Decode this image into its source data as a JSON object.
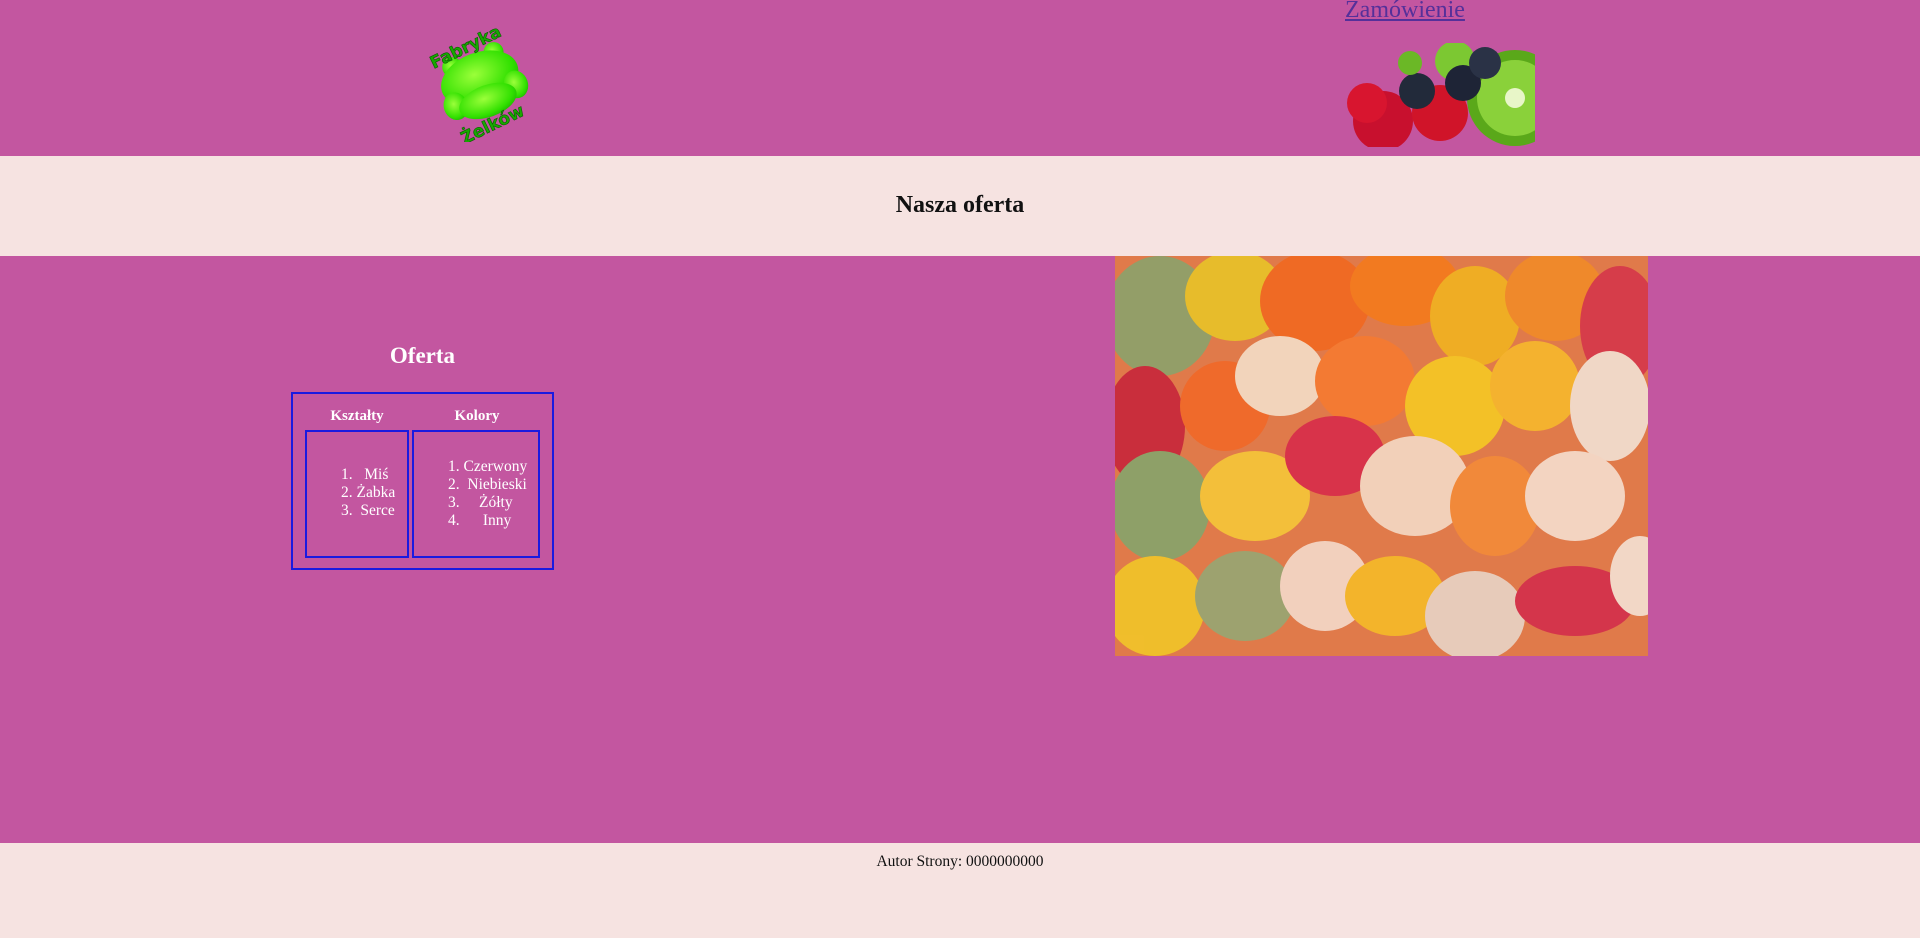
{
  "header": {
    "logo": {
      "text_top": "Fabryka",
      "text_bottom": "Żelków",
      "icon": "gummy-bear-logo-icon"
    },
    "order_link": "Zamówienie",
    "fruit_image_icon": "fruit-jellies-image"
  },
  "title": "Nasza oferta",
  "offer": {
    "heading": "Oferta",
    "columns": [
      "Kształty",
      "Kolory"
    ],
    "shapes": [
      "Miś",
      "Żabka",
      "Serce"
    ],
    "colors": [
      "Czerwony",
      "Niebieski",
      "Żółty",
      "Inny"
    ]
  },
  "candy_image_icon": "gummy-bears-photo",
  "footer": {
    "author": "Autor Strony: 0000000000"
  },
  "colors": {
    "accent": "#c356a0",
    "band": "#f6e3e1",
    "border": "#1a1ae0",
    "link": "#55309a"
  }
}
